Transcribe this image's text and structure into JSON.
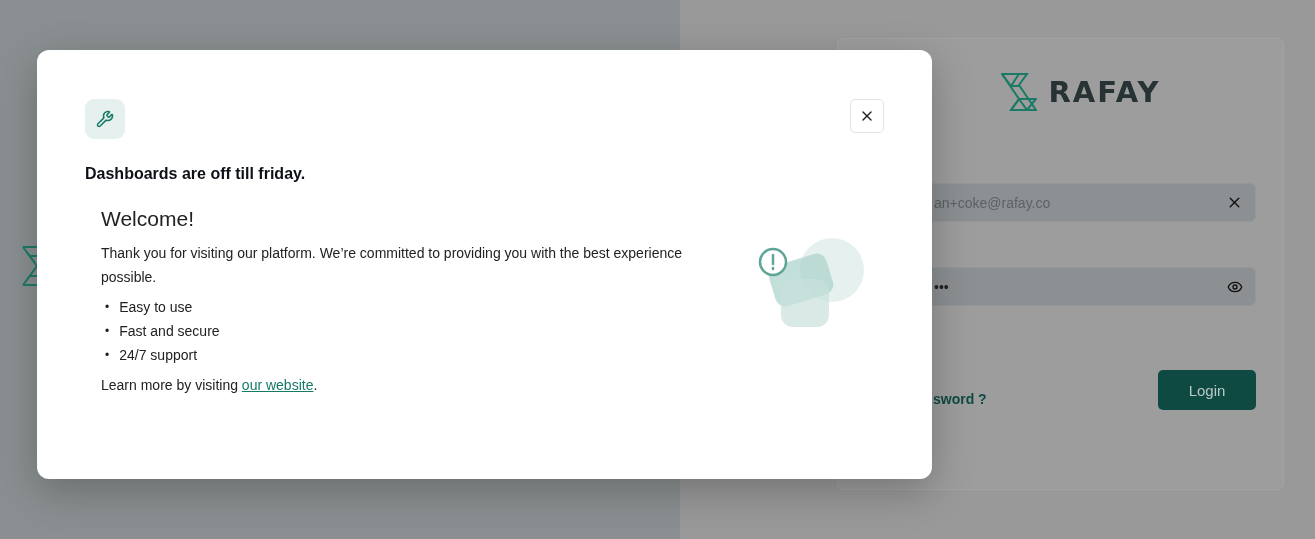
{
  "modal": {
    "title": "Dashboards are off till friday.",
    "heading": "Welcome!",
    "intro": "Thank you for visiting our platform. We’re committed to providing you with the best experience possible.",
    "features": [
      {
        "bullet": "•",
        "text": "Easy to use"
      },
      {
        "bullet": "•",
        "text": "Fast and secure"
      },
      {
        "bullet": "•",
        "text": "24/7 support"
      }
    ],
    "footer": {
      "before": "Learn more by visiting ",
      "link": "our website",
      "after": "."
    }
  },
  "login": {
    "logo_text": "RAFAY",
    "email_value": "an+coke@rafay.co",
    "password_value": "•••",
    "forgot_link": "sword ?",
    "login_button": "Login"
  }
}
